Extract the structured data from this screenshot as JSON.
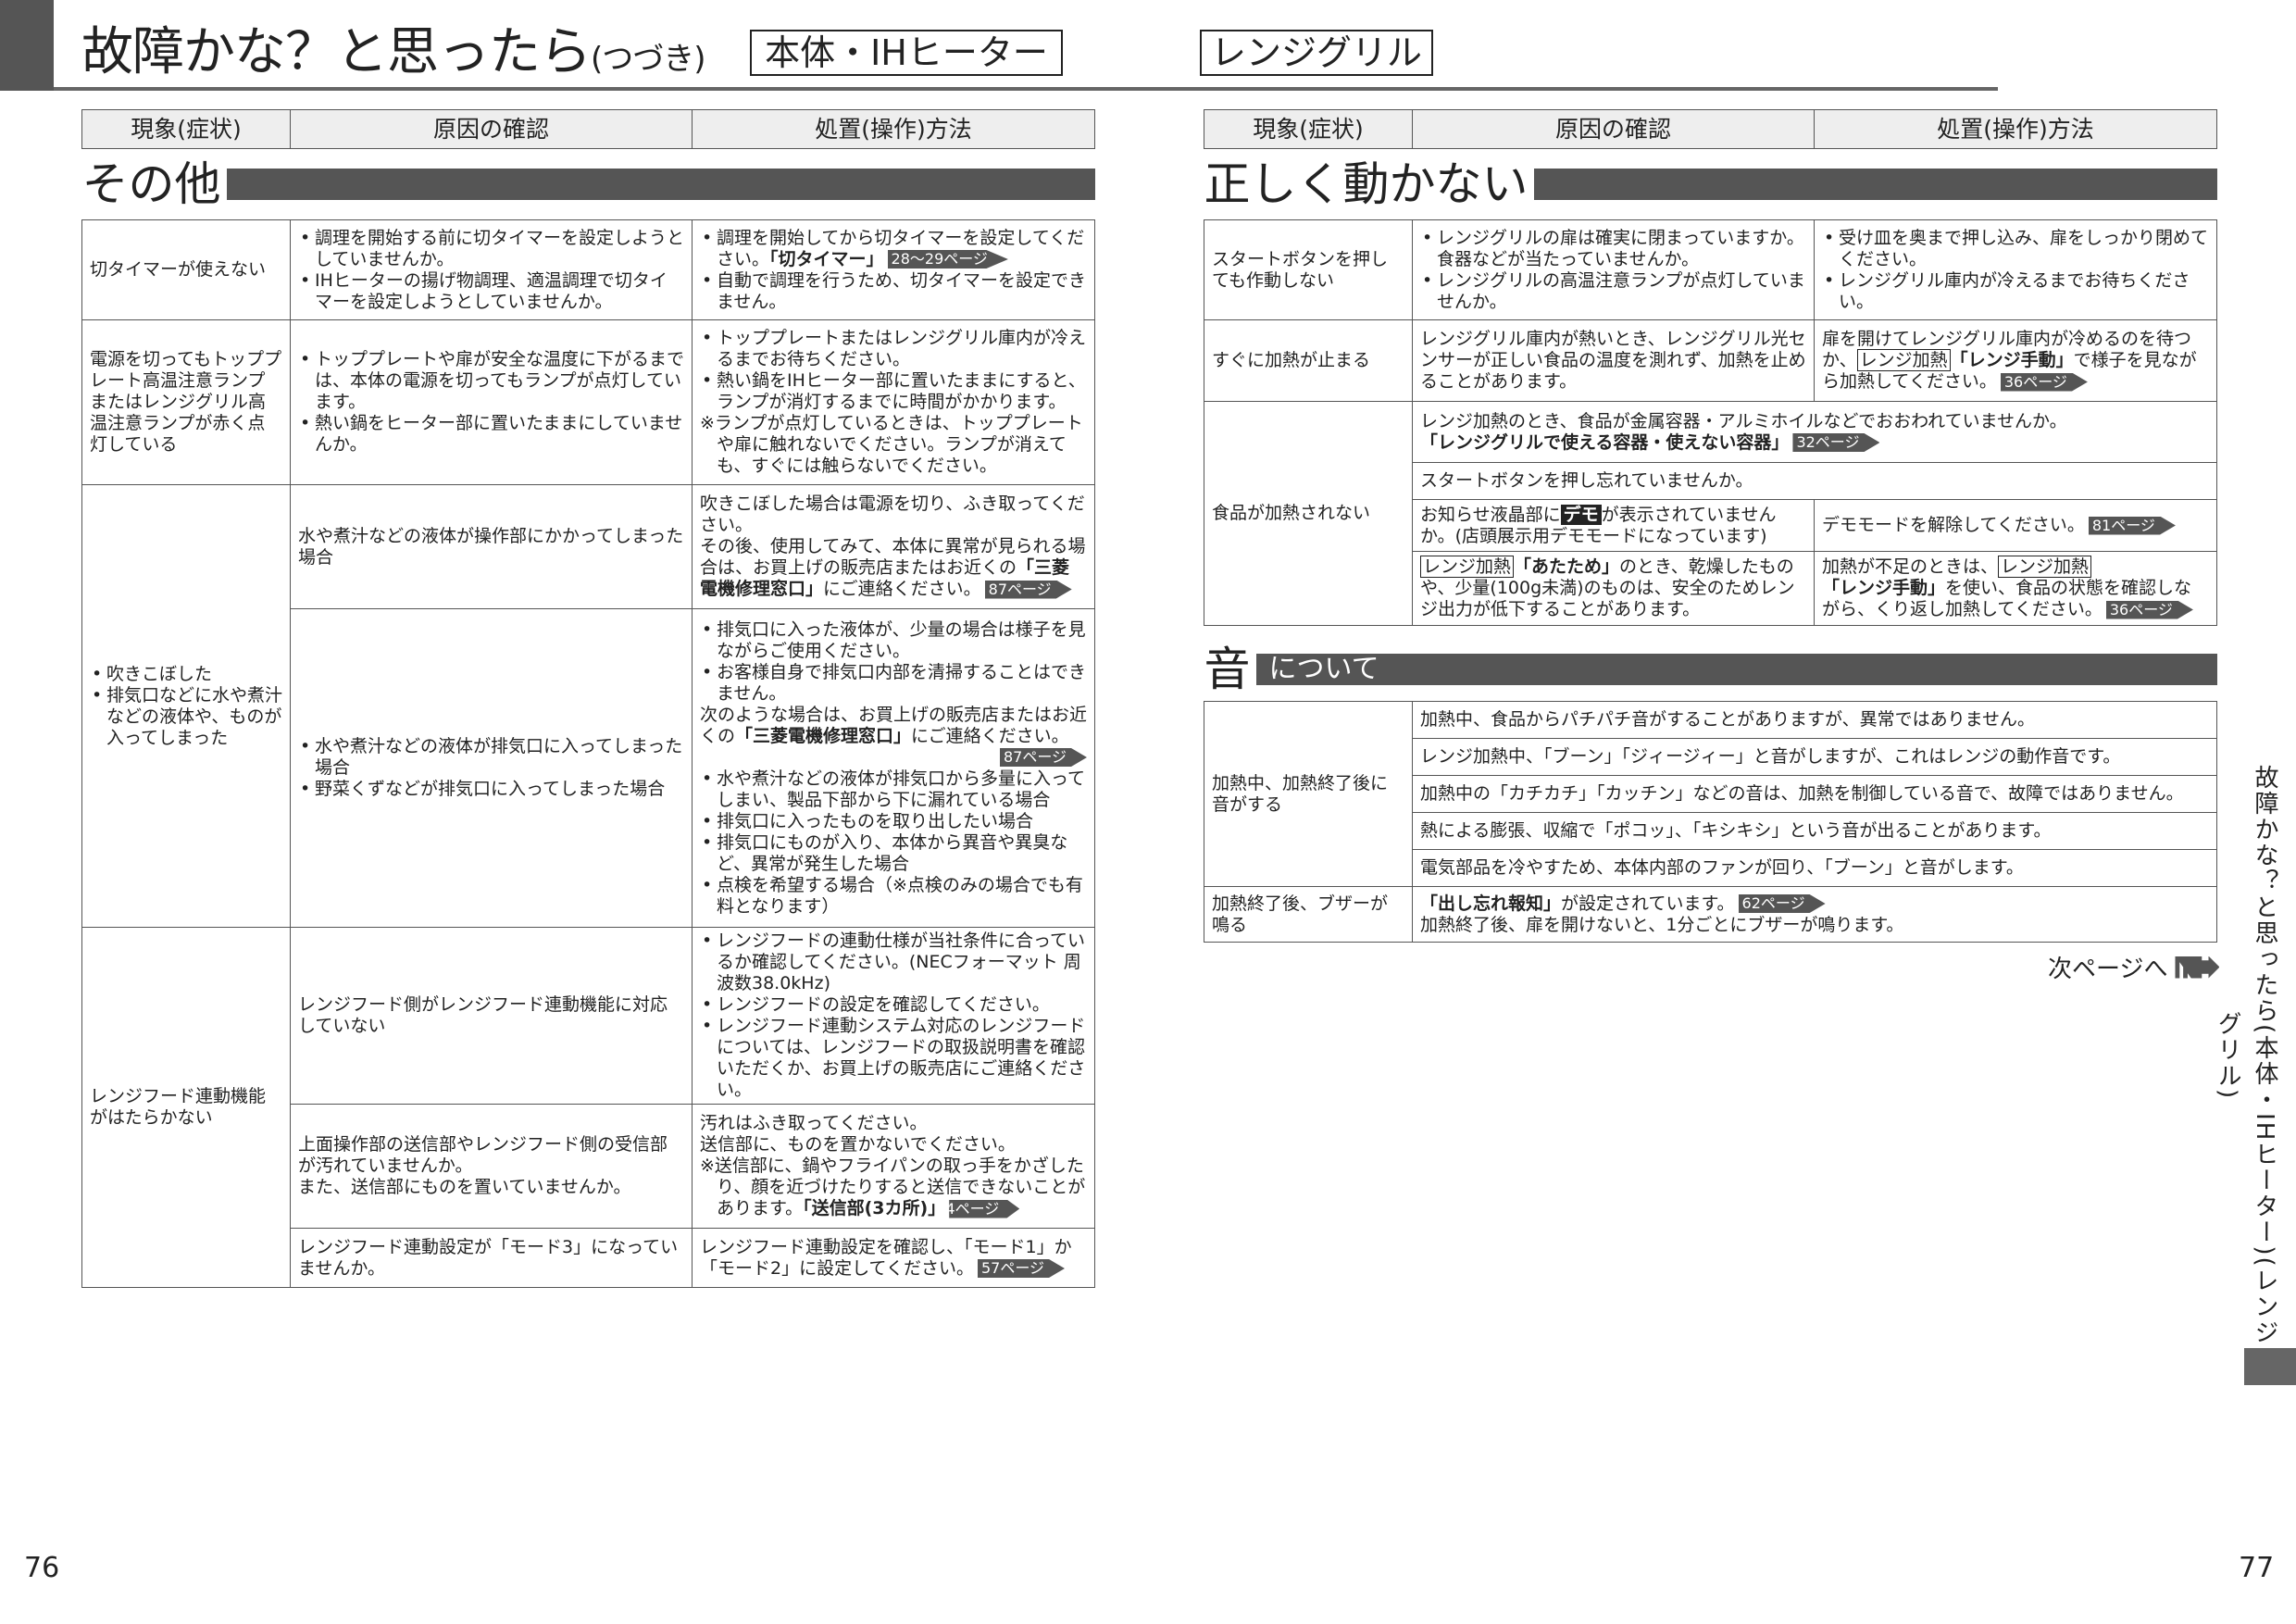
{
  "header": {
    "title": "故障かな？と思ったら",
    "title_sub": "(つづき)",
    "tag_left": "本体・IHヒーター",
    "tag_right": "レンジグリル"
  },
  "columns": {
    "symptom": "現象(症状)",
    "cause": "原因の確認",
    "remedy": "処置(操作)方法"
  },
  "left": {
    "section": "その他",
    "r1": {
      "symptom": "切タイマーが使えない",
      "cause": [
        "調理を開始する前に切タイマーを設定しようとしていませんか。",
        "IHヒーターの揚げ物調理、適温調理で切タイマーを設定しようとしていませんか。"
      ],
      "remedy1_pre": "調理を開始してから切タイマーを設定してください。",
      "remedy1_kw": "「切タイマー」",
      "remedy1_ref": "28～29ページ",
      "remedy2": "自動で調理を行うため、切タイマーを設定できません。"
    },
    "r2": {
      "symptom": "電源を切ってもトッププレート高温注意ランプまたはレンジグリル高温注意ランプが赤く点灯している",
      "cause": [
        "トッププレートや扉が安全な温度に下がるまでは、本体の電源を切ってもランプが点灯しています。",
        "熱い鍋をヒーター部に置いたままにしていませんか。"
      ],
      "remedy": [
        "トッププレートまたはレンジグリル庫内が冷えるまでお待ちください。",
        "熱い鍋をIHヒーター部に置いたままにすると、ランプが消灯するまでに時間がかかります。"
      ],
      "remedy_note": "※ランプが点灯しているときは、トッププレートや扉に触れないでください。ランプが消えても、すぐには触らないでください。"
    },
    "r3": {
      "symptom": [
        "吹きこぼした",
        "排気口などに水や煮汁などの液体や、ものが入ってしまった"
      ],
      "causeA": "水や煮汁などの液体が操作部にかかってしまった場合",
      "remedyA_1": "吹きこぼした場合は電源を切り、ふき取ってください。",
      "remedyA_2": "その後、使用してみて、本体に異常が見られる場合は、お買上げの販売店またはお近くの",
      "remedyA_kw": "「三菱電機修理窓口」",
      "remedyA_3": "にご連絡ください。",
      "remedyA_ref": "87ページ",
      "causeB": [
        "水や煮汁などの液体が排気口に入ってしまった場合",
        "野菜くずなどが排気口に入ってしまった場合"
      ],
      "remedyB_top": [
        "排気口に入った液体が、少量の場合は様子を見ながらご使用ください。",
        "お客様自身で排気口内部を清掃することはできません。"
      ],
      "remedyB_mid1": "次のような場合は、お買上げの販売店またはお近くの",
      "remedyB_kw": "「三菱電機修理窓口」",
      "remedyB_mid2": "にご連絡ください。",
      "remedyB_ref": "87ページ",
      "remedyB_bottom": [
        "水や煮汁などの液体が排気口から多量に入ってしまい、製品下部から下に漏れている場合",
        "排気口に入ったものを取り出したい場合",
        "排気口にものが入り、本体から異音や異臭など、異常が発生した場合",
        "点検を希望する場合（※点検のみの場合でも有料となります）"
      ]
    },
    "r4": {
      "symptom": "レンジフード連動機能がはたらかない",
      "causeA": "レンジフード側がレンジフード連動機能に対応していない",
      "remedyA": [
        "レンジフードの連動仕様が当社条件に合っているか確認してください。(NECフォーマット 周波数38.0kHz)",
        "レンジフードの設定を確認してください。",
        "レンジフード連動システム対応のレンジフードについては、レンジフードの取扱説明書を確認いただくか、お買上げの販売店にご連絡ください。"
      ],
      "causeB": "上面操作部の送信部やレンジフード側の受信部が汚れていませんか。\nまた、送信部にものを置いていませんか。",
      "remedyB_1": "汚れはふき取ってください。",
      "remedyB_2": "送信部に、ものを置かないでください。",
      "remedyB_note": "※送信部に、鍋やフライパンの取っ手をかざしたり、顔を近づけたりすると送信できないことがあります。",
      "remedyB_kw": "「送信部(3カ所)」",
      "remedyB_ref": "14ページ",
      "causeC": "レンジフード連動設定が「モード3」になっていませんか。",
      "remedyC": "レンジフード連動設定を確認し、「モード1」か「モード2」に設定してください。",
      "remedyC_ref": "57ページ"
    }
  },
  "right": {
    "section1": "正しく動かない",
    "r1": {
      "symptom": "スタートボタンを押しても作動しない",
      "cause": [
        "レンジグリルの扉は確実に閉まっていますか。食器などが当たっていませんか。",
        "レンジグリルの高温注意ランプが点灯していませんか。"
      ],
      "remedy": [
        "受け皿を奥まで押し込み、扉をしっかり閉めてください。",
        "レンジグリル庫内が冷えるまでお待ちください。"
      ]
    },
    "r2": {
      "symptom": "すぐに加熱が止まる",
      "cause": "レンジグリル庫内が熱いとき、レンジグリル光センサーが正しい食品の温度を測れず、加熱を止めることがあります。",
      "remedy1": "扉を開けてレンジグリル庫内が冷めるのを待つか、",
      "remedy_kw1": "レンジ加熱",
      "remedy_kw2": "「レンジ手動」",
      "remedy2": "で様子を見ながら加熱してください。",
      "remedy_ref": "36ページ"
    },
    "r3": {
      "symptom": "食品が加熱されない",
      "a1": "レンジ加熱のとき、食品が金属容器・アルミホイルなどでおおわれていませんか。",
      "a2": "「レンジグリルで使える容器・使えない容器」",
      "a_ref": "32ページ",
      "b": "スタートボタンを押し忘れていませんか。",
      "c_cause1": "お知らせ液晶部に",
      "c_badge": "デモ",
      "c_cause2": "が表示されていませんか。(店頭展示用デモモードになっています)",
      "c_remedy": "デモモードを解除してください。",
      "c_ref": "81ページ",
      "d_kw1": "レンジ加熱",
      "d_kw2": "「あたため」",
      "d_cause": "のとき、乾燥したものや、少量(100g未満)のものは、安全のためレンジ出力が低下することがあります。",
      "d_remedy1": "加熱が不足のときは、",
      "d_kw3": "レンジ加熱",
      "d_kw4": "「レンジ手動」",
      "d_remedy2": "を使い、食品の状態を確認しながら、くり返し加熱してください。",
      "d_ref": "36ページ"
    },
    "section2_char": "音",
    "section2_label": "について",
    "r4": {
      "symptom": "加熱中、加熱終了後に音がする",
      "items": [
        "加熱中、食品からパチパチ音がすることがありますが、異常ではありません。",
        "レンジ加熱中、「ブーン」「ジィージィー」と音がしますが、これはレンジの動作音です。",
        "加熱中の「カチカチ」「カッチン」などの音は、加熱を制御している音で、故障ではありません。",
        "熱による膨張、収縮で「ポコッ」、「キシキシ」という音が出ることがあります。",
        "電気部品を冷やすため、本体内部のファンが回り、「ブーン」と音がします。"
      ]
    },
    "r5": {
      "symptom": "加熱終了後、ブザーが鳴る",
      "kw": "「出し忘れ報知」",
      "cause1": "が設定されています。",
      "ref": "62ページ",
      "cause2": "加熱終了後、扉を開けないと、1分ごとにブザーが鳴ります。"
    }
  },
  "next_page": "次ページへ",
  "side_label": "故障かな？と思ったら(本体・IHヒーター)(レンジグリル)",
  "page_left": "76",
  "page_right": "77"
}
